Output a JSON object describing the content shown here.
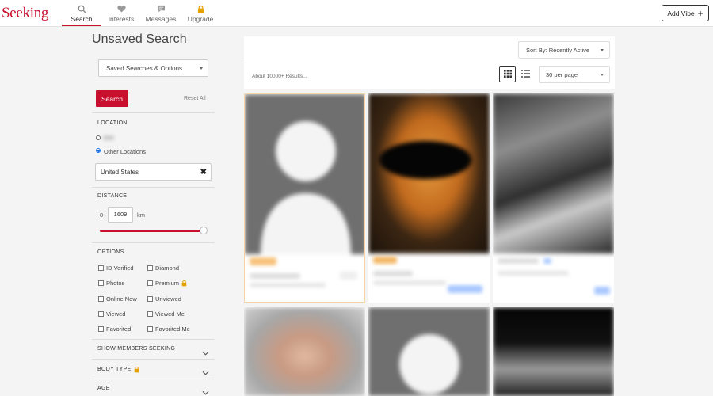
{
  "app": {
    "logo": "Seeking",
    "nav": [
      {
        "label": "Search",
        "icon": "search-icon",
        "active": true
      },
      {
        "label": "Interests",
        "icon": "heart-icon",
        "active": false
      },
      {
        "label": "Messages",
        "icon": "message-icon",
        "active": false
      },
      {
        "label": "Upgrade",
        "icon": "lock-icon",
        "active": false
      }
    ],
    "add_vibe_label": "Add Vibe"
  },
  "sidebar": {
    "title": "Unsaved Search",
    "saved_searches_label": "Saved Searches & Options",
    "search_button": "Search",
    "reset_label": "Reset All",
    "location": {
      "heading": "LOCATION",
      "other_locations_label": "Other Locations",
      "selected": "Other Locations",
      "location_value": "United States"
    },
    "distance": {
      "heading": "DISTANCE",
      "from": "0 -",
      "value": "1609",
      "unit": "km",
      "slider_fraction": 0.95
    },
    "options": {
      "heading": "OPTIONS",
      "items": [
        {
          "label": "ID Verified",
          "checked": false,
          "locked": false
        },
        {
          "label": "Diamond",
          "checked": false,
          "locked": false
        },
        {
          "label": "Photos",
          "checked": false,
          "locked": false
        },
        {
          "label": "Premium",
          "checked": false,
          "locked": true
        },
        {
          "label": "Online Now",
          "checked": false,
          "locked": false
        },
        {
          "label": "Unviewed",
          "checked": false,
          "locked": false
        },
        {
          "label": "Viewed",
          "checked": false,
          "locked": false
        },
        {
          "label": "Viewed Me",
          "checked": false,
          "locked": false
        },
        {
          "label": "Favorited",
          "checked": false,
          "locked": false
        },
        {
          "label": "Favorited Me",
          "checked": false,
          "locked": false
        }
      ]
    },
    "sections": [
      {
        "label": "SHOW MEMBERS SEEKING",
        "locked": false
      },
      {
        "label": "BODY TYPE",
        "locked": true
      },
      {
        "label": "AGE",
        "locked": false
      }
    ]
  },
  "results": {
    "sort_label": "Sort By: Recently Active",
    "count_label": "About 10000+ Results...",
    "per_page_label": "30 per page",
    "view_mode": "grid"
  },
  "colors": {
    "brand": "#c8102e",
    "accent": "#1a73e8",
    "badge": "#f5a623",
    "lock": "#e6a100"
  }
}
